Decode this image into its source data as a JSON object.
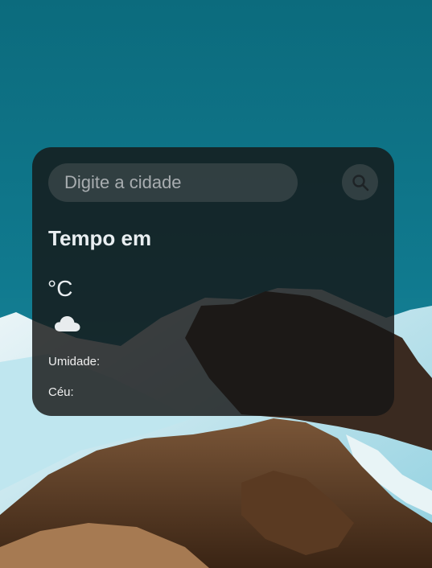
{
  "search": {
    "placeholder": "Digite a cidade",
    "value": "",
    "button_icon": "search-icon"
  },
  "weather": {
    "title": "Tempo em",
    "temperature": "°C",
    "condition_icon": "cloud-icon",
    "humidity_label": "Umidade:",
    "sky_label": "Céu:"
  },
  "colors": {
    "card_background": "#161616",
    "text": "#e9eef1",
    "sky": "#0f7487"
  }
}
